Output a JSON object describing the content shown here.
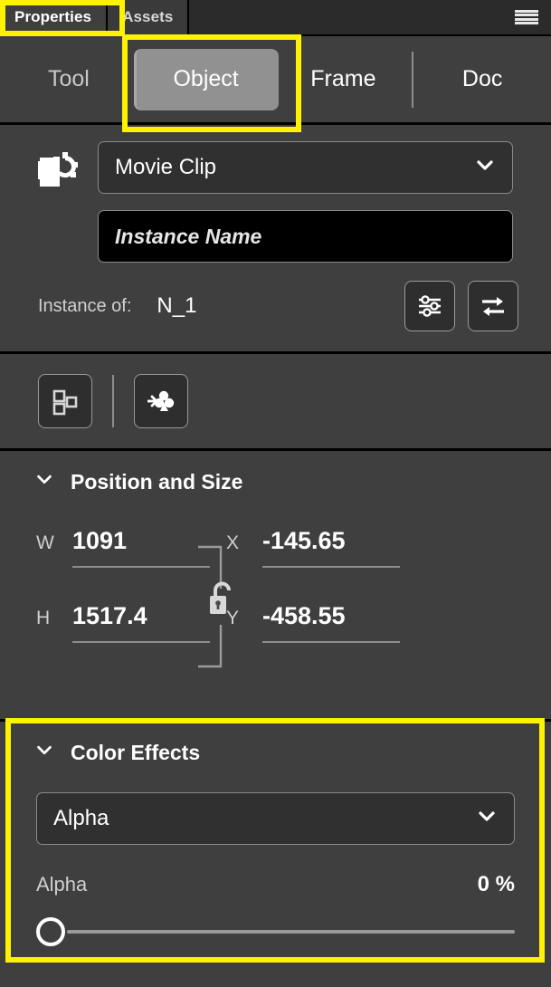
{
  "window": {
    "tabs": [
      {
        "label": "Properties",
        "active": true
      },
      {
        "label": "Assets",
        "active": false
      }
    ],
    "menu_icon": "hamburger-menu-icon"
  },
  "subtabs": [
    {
      "label": "Tool",
      "selected": false
    },
    {
      "label": "Object",
      "selected": true
    },
    {
      "label": "Frame",
      "selected": false
    },
    {
      "label": "Doc",
      "selected": false
    }
  ],
  "symbol": {
    "icon": "movie-clip-symbol-icon",
    "type_value": "Movie Clip",
    "instance_name_placeholder": "Instance Name",
    "instance_name_value": "",
    "instance_of_label": "Instance of:",
    "instance_of_value": "N_1",
    "buttons": [
      {
        "icon": "sliders-settings-icon"
      },
      {
        "icon": "swap-symbol-icon"
      }
    ]
  },
  "tools": [
    {
      "icon": "blend-objects-icon"
    },
    {
      "icon": "add-filter-icon"
    }
  ],
  "position_and_size": {
    "title": "Position and Size",
    "chevron": "chevron-down-icon",
    "lock_icon": "unlocked-padlock-icon",
    "fields": [
      {
        "label": "W",
        "value": "1091"
      },
      {
        "label": "X",
        "value": "-145.65"
      },
      {
        "label": "H",
        "value": "1517.4"
      },
      {
        "label": "Y",
        "value": "-458.55"
      }
    ]
  },
  "color_effects": {
    "title": "Color Effects",
    "chevron": "chevron-down-icon",
    "effect_value": "Alpha",
    "alpha_label": "Alpha",
    "alpha_value": "0 %",
    "alpha_percent": 0
  },
  "colors": {
    "panel_bg": "#3f3f3f",
    "tabstrip_bg": "#2b2b2b",
    "field_bg": "#303030",
    "input_bg": "#000000",
    "selected_tab_bg": "#919191",
    "annotation": "#fff200",
    "text": "#ffffff",
    "muted_text": "#cfcfcf"
  }
}
